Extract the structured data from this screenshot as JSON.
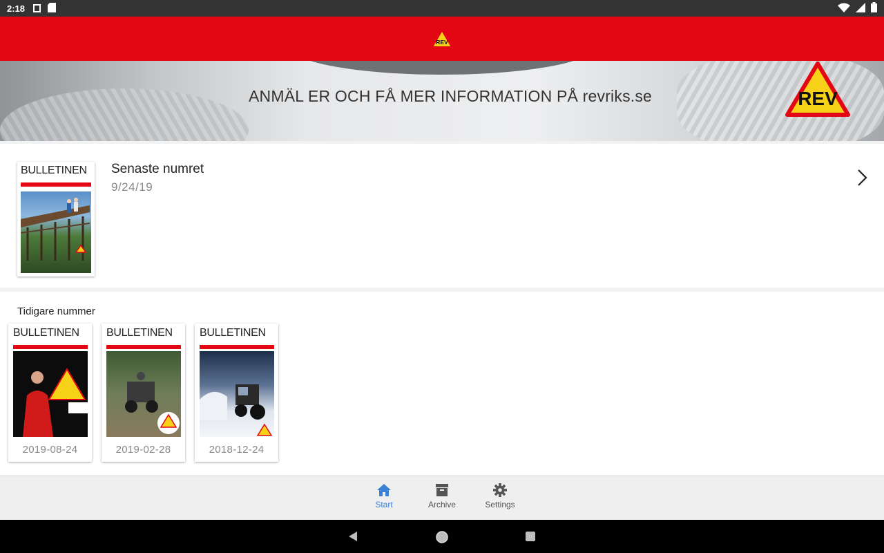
{
  "status": {
    "time": "2:18"
  },
  "banner": {
    "text": "ANMÄL ER OCH FÅ MER INFORMATION PÅ revriks.se",
    "logo_text": "REV"
  },
  "appbar": {
    "logo_text": "REV"
  },
  "latest": {
    "title": "Senaste numret",
    "date": "9/24/19",
    "cover_title": "BULLETINEN"
  },
  "earlier": {
    "heading": "Tidigare nummer",
    "issues": [
      {
        "title": "BULLETINEN",
        "date": "2019-08-24"
      },
      {
        "title": "BULLETINEN",
        "date": "2019-02-28"
      },
      {
        "title": "BULLETINEN",
        "date": "2018-12-24"
      }
    ]
  },
  "nav": {
    "start": "Start",
    "archive": "Archive",
    "settings": "Settings"
  },
  "colors": {
    "brand_red": "#e30613",
    "nav_active": "#3b82d6",
    "logo_yellow": "#f7d117"
  }
}
